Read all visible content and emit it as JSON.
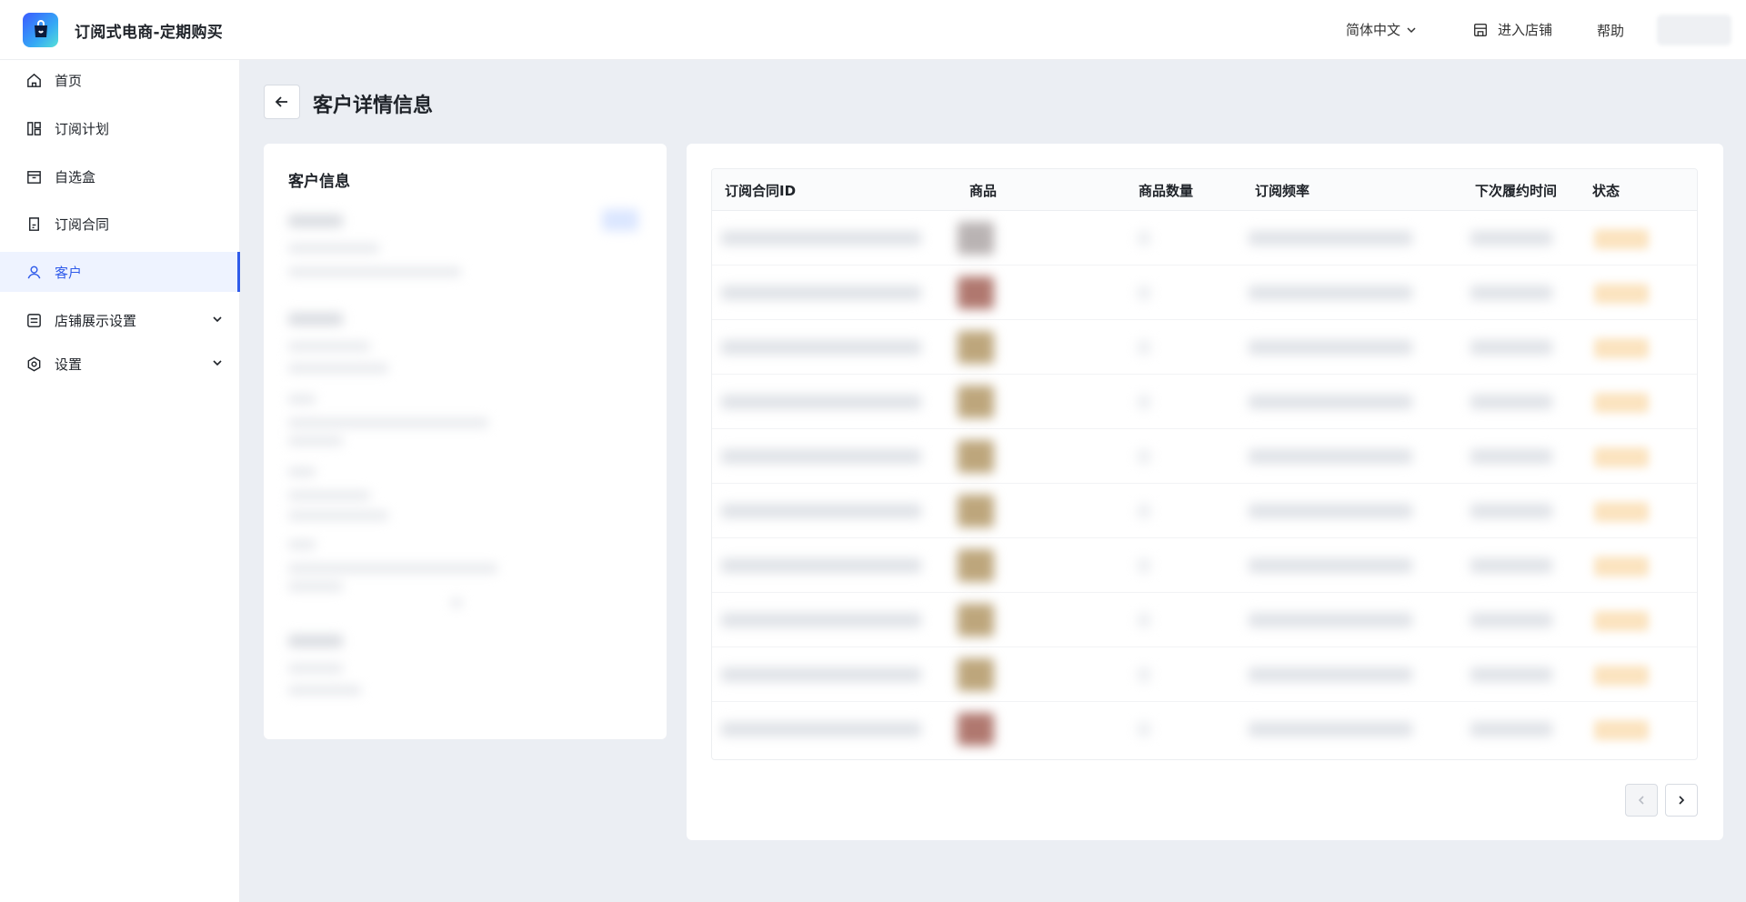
{
  "app": {
    "title": "订阅式电商-定期购买"
  },
  "header": {
    "language": "简体中文",
    "enter_store": "进入店铺",
    "help": "帮助"
  },
  "sidebar": {
    "items": [
      {
        "label": "首页",
        "icon": "home-icon",
        "active": false
      },
      {
        "label": "订阅计划",
        "icon": "layout-icon",
        "active": false
      },
      {
        "label": "自选盒",
        "icon": "box-icon",
        "active": false
      },
      {
        "label": "订阅合同",
        "icon": "contract-icon",
        "active": false
      },
      {
        "label": "客户",
        "icon": "user-icon",
        "active": true
      },
      {
        "label": "店铺展示设置",
        "icon": "display-icon",
        "active": false,
        "expandable": true
      },
      {
        "label": "设置",
        "icon": "settings-icon",
        "active": false,
        "expandable": true
      }
    ]
  },
  "page": {
    "title": "客户详情信息"
  },
  "customer_card": {
    "title": "客户信息"
  },
  "table": {
    "columns": [
      "订阅合同ID",
      "商品",
      "商品数量",
      "订阅频率",
      "下次履约时间",
      "状态"
    ],
    "row_count": 10,
    "thumb_colors": [
      "#b9b3b3",
      "#b0786f",
      "#bda67c",
      "#bda67c",
      "#bda67c",
      "#bda67c",
      "#bda67c",
      "#bda67c",
      "#bda67c",
      "#b0786f"
    ]
  },
  "colors": {
    "accent": "#2f5bea",
    "status": "#fbe3bf"
  }
}
